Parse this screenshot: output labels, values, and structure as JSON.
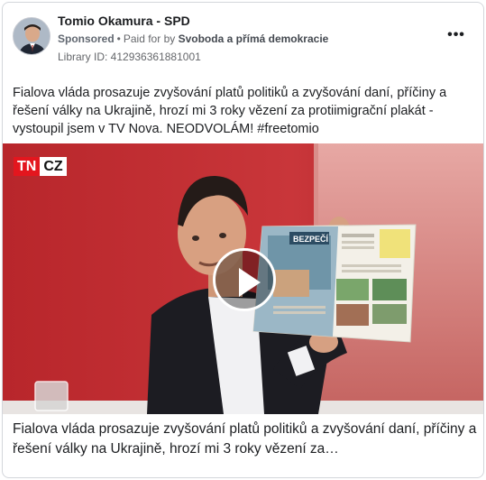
{
  "header": {
    "page_name": "Tomio Okamura - SPD",
    "sponsored_label": "Sponsored",
    "separator": "•",
    "paid_for_label": "Paid for by",
    "funder": "Svoboda a přímá demokracie",
    "library_id": "Library ID: 412936361881001",
    "more_glyph": "•••"
  },
  "ad": {
    "text": "Fialova vláda prosazuje zvyšování platů politiků a zvyšování daní, příčiny a řešení války na Ukrajině, hrozí mi 3 roky vězení za protiimigrační plakát - vystoupil jsem v TV Nova. NEODVOLÁM! #freetomio"
  },
  "video": {
    "channel_tn": "TN",
    "channel_cz": "CZ",
    "booklet_heading": "BEZPEČÍ"
  },
  "caption": {
    "text": "Fialova vláda prosazuje zvyšování platů politiků a zvyšování daní, příčiny a řešení války na Ukrajině, hrozí mi 3 roky vězení za…"
  },
  "colors": {
    "brand_red": "#e3161e",
    "studio_red": "#b22e2e",
    "text": "#1c1e21",
    "muted": "#65676b"
  },
  "icons": [
    "more-options-icon",
    "play-icon"
  ]
}
